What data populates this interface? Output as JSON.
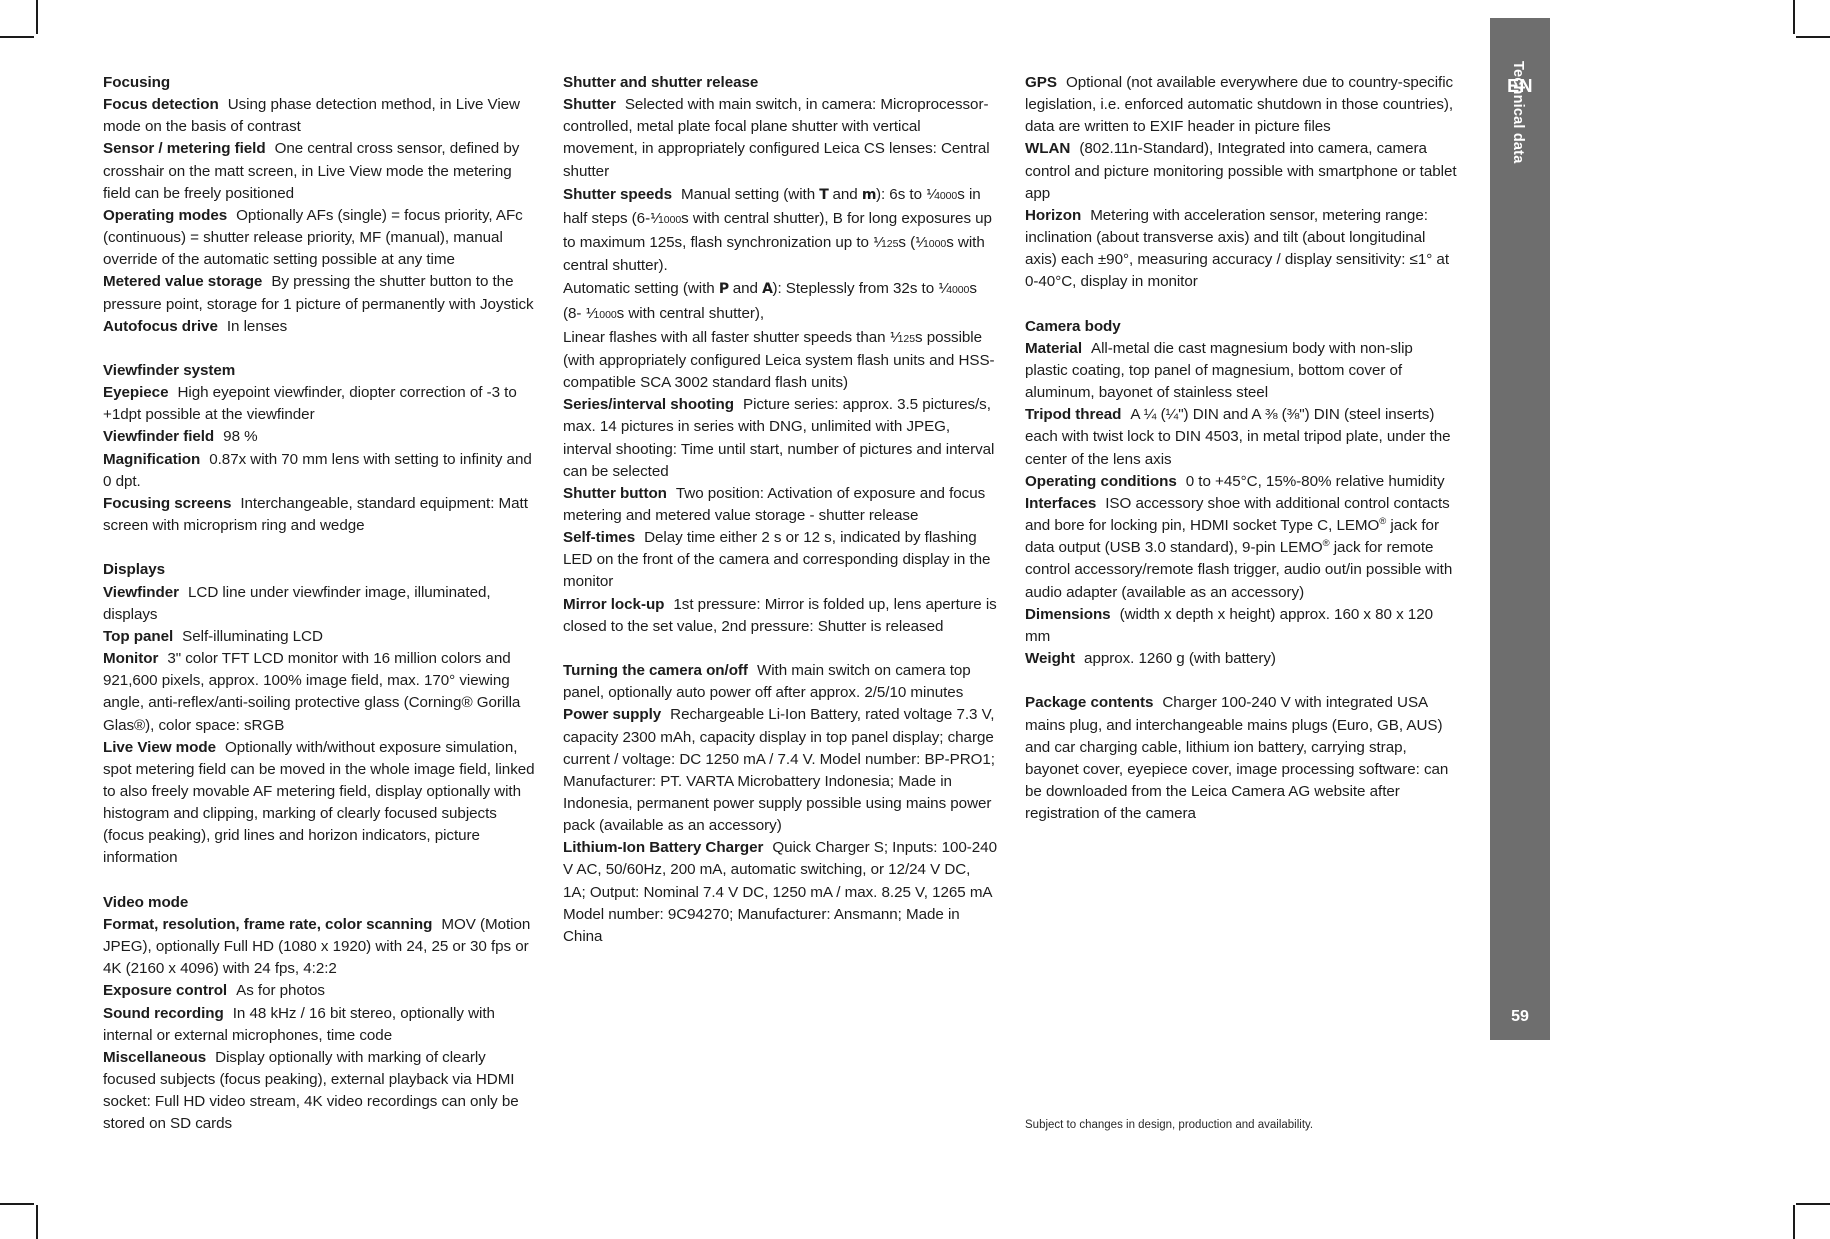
{
  "sidetab": {
    "language": "EN",
    "section": "Technical data",
    "page_number": "59",
    "bg_color": "#6e6e6e"
  },
  "footnote": "Subject to changes in design, production and availability.",
  "columns": [
    {
      "id": "column-1",
      "blocks": [
        {
          "type": "heading",
          "text": "Focusing"
        },
        {
          "type": "entry",
          "term": "Focus detection",
          "value": "Using phase detection method, in Live View mode on the basis of contrast"
        },
        {
          "type": "entry",
          "term": "Sensor / metering field",
          "value": "One central cross sensor, defined by crosshair on the matt screen, in Live View mode the metering field can be freely positioned"
        },
        {
          "type": "entry",
          "term": "Operating modes",
          "value": "Optionally AFs (single) = focus priority, AFc (continuous) = shutter release priority, MF (manual), manual override of the automatic setting possible at any time"
        },
        {
          "type": "entry",
          "term": "Metered value storage",
          "value": "By pressing the shutter button to the pressure point, storage for 1 picture of permanently with Joystick"
        },
        {
          "type": "entry",
          "term": "Autofocus drive",
          "value": "In lenses"
        },
        {
          "type": "spacer"
        },
        {
          "type": "heading",
          "text": "Viewfinder system"
        },
        {
          "type": "entry",
          "term": "Eyepiece",
          "value": "High eyepoint viewfinder, diopter correction of -3 to +1dpt possible at the viewfinder"
        },
        {
          "type": "entry",
          "term": "Viewfinder field",
          "value": "98 %"
        },
        {
          "type": "entry",
          "term": "Magnification",
          "value": "0.87x with 70 mm lens with setting to infinity and 0 dpt."
        },
        {
          "type": "entry",
          "term": "Focusing screens",
          "value": "Interchangeable, standard equipment: Matt screen with microprism ring and wedge"
        },
        {
          "type": "spacer"
        },
        {
          "type": "heading",
          "text": "Displays"
        },
        {
          "type": "entry",
          "term": "Viewfinder",
          "value": "LCD line under viewfinder image, illuminated, displays"
        },
        {
          "type": "entry",
          "term": "Top panel",
          "value": "Self-illuminating LCD"
        },
        {
          "type": "entry",
          "term": "Monitor",
          "value": "3\" color TFT LCD monitor with 16 million colors and 921,600 pixels, approx. 100% image field, max. 170° viewing angle, anti-reflex/anti-soiling protective glass (Corning® Gorilla Glas®), color space: sRGB"
        },
        {
          "type": "entry",
          "term": "Live View mode",
          "value": "Optionally with/without exposure simulation, spot metering field can be moved in the whole image field, linked to also freely movable AF metering field, display optionally with histogram and clipping, marking of clearly focused subjects (focus peaking), grid lines and horizon indicators, picture information"
        },
        {
          "type": "spacer"
        },
        {
          "type": "heading",
          "text": "Video mode"
        },
        {
          "type": "entry",
          "term": "Format, resolution, frame rate, color scanning",
          "value": "MOV (Motion JPEG), optionally Full HD (1080 x 1920) with 24, 25 or 30 fps or 4K (2160 x 4096) with 24 fps, 4:2:2"
        },
        {
          "type": "entry",
          "term": "Exposure control",
          "value": "As for photos"
        },
        {
          "type": "entry",
          "term": "Sound recording",
          "value": "In 48 kHz / 16 bit stereo, optionally with internal or external microphones, time code"
        },
        {
          "type": "entry",
          "term": "Miscellaneous",
          "value": "Display optionally with marking of clearly focused subjects (focus peaking), external playback via HDMI socket: Full HD video stream, 4K video recordings can only be stored on SD cards"
        }
      ]
    },
    {
      "id": "column-2",
      "blocks": [
        {
          "type": "heading",
          "text": "Shutter and shutter release"
        },
        {
          "type": "entry",
          "term": "Shutter",
          "value": "Selected with main switch, in camera: Microprocessor-controlled, metal plate focal plane shutter with vertical movement, in appropriately configured Leica CS lenses: Central shutter"
        },
        {
          "type": "entry-rich",
          "term": "Shutter speeds",
          "value_html": "Manual setting (with <span class=\"lcd\">T</span> and <span class=\"lcd\">m</span>): 6s to <span class=\"frac\"><span class=\"num\">⅟</span><span class=\"den\">4000</span></span>s in half steps (6-<span class=\"frac\"><span class=\"num\">⅟</span><span class=\"den\">1000</span></span>s with central shutter), B for long exposures up to maximum 125s, flash synchronization up to <span class=\"frac\"><span class=\"num\">⅟</span><span class=\"den\">125</span></span>s (<span class=\"frac\"><span class=\"num\">⅟</span><span class=\"den\">1000</span></span>s with central shutter)."
        },
        {
          "type": "entry-rich",
          "term": "",
          "value_html": "Automatic setting (with <span class=\"lcd\">P</span> and <span class=\"lcd\">A</span>): Steplessly from 32s to <span class=\"frac\"><span class=\"num\">⅟</span><span class=\"den\">4000</span></span>s (8- <span class=\"frac\"><span class=\"num\">⅟</span><span class=\"den\">1000</span></span>s with central shutter),"
        },
        {
          "type": "entry-rich",
          "term": "",
          "value_html": "Linear flashes with all faster shutter speeds than <span class=\"frac\"><span class=\"num\">⅟</span><span class=\"den\">125</span></span>s possible (with appropriately configured Leica system flash units and HSS-compatible SCA 3002 standard flash units)"
        },
        {
          "type": "entry",
          "term": "Series/interval shooting",
          "value": "Picture series: approx. 3.5 pictures/s, max. 14 pictures in series with DNG, unlimited with JPEG, interval shooting: Time until start, number of pictures and interval can be selected"
        },
        {
          "type": "entry",
          "term": "Shutter button",
          "value": "Two position: Activation of exposure and focus metering and metered value storage - shutter release"
        },
        {
          "type": "entry",
          "term": "Self-times",
          "value": "Delay time either 2 s or 12 s, indicated by flashing LED on the front of the camera and corresponding display in the monitor"
        },
        {
          "type": "entry",
          "term": "Mirror lock-up",
          "value": "1st pressure: Mirror is folded up, lens aperture is closed to the set value, 2nd pressure: Shutter is released"
        },
        {
          "type": "spacer"
        },
        {
          "type": "entry",
          "term": "Turning the camera on/off",
          "value": "With main switch on camera top panel, optionally auto power off after approx. 2/5/10 minutes"
        },
        {
          "type": "entry",
          "term": "Power supply",
          "value": "Rechargeable Li-Ion Battery, rated voltage 7.3 V, capacity 2300 mAh, capacity display in top  panel display; charge current / voltage: DC 1250 mA / 7.4 V. Model number: BP-PRO1; Manufacturer: PT. VARTA Microbattery Indonesia; Made in Indonesia, permanent power supply possible using mains power pack (available as an accessory)"
        },
        {
          "type": "entry",
          "term": "Lithium-Ion Battery Charger",
          "value": "Quick Charger S; Inputs: 100-240 V AC, 50/60Hz, 200 mA, automatic switching, or 12/24 V DC, 1A; Output: Nominal 7.4 V DC, 1250 mA / max. 8.25 V, 1265 mA Model number: 9C94270; Manufacturer: Ansmann; Made in China"
        }
      ]
    },
    {
      "id": "column-3",
      "blocks": [
        {
          "type": "entry",
          "term": "GPS",
          "value": "Optional (not available everywhere due to country-specific legislation, i.e. enforced automatic shutdown in those countries), data are written to EXIF header in picture files"
        },
        {
          "type": "entry",
          "term": "WLAN",
          "value": "(802.11n-Standard), Integrated into camera, camera control and picture monitoring possible with smartphone or tablet app"
        },
        {
          "type": "entry",
          "term": "Horizon",
          "value": "Metering with acceleration sensor, metering range: inclination (about transverse axis) and tilt (about longitudinal axis) each ±90°, measuring accuracy / display sensitivity: ≤1° at 0-40°C, display in monitor"
        },
        {
          "type": "spacer"
        },
        {
          "type": "heading",
          "text": "Camera body"
        },
        {
          "type": "entry",
          "term": "Material",
          "value": "All-metal die cast magnesium body with non-slip plastic coating, top panel of magnesium, bottom cover of aluminum, bayonet of stainless steel"
        },
        {
          "type": "entry",
          "term": "Tripod thread",
          "value": "A ¼ (¼\") DIN and A ⅜ (⅜\") DIN (steel inserts) each with twist lock to DIN 4503, in metal tripod plate, under the center of the lens axis"
        },
        {
          "type": "entry",
          "term": "Operating conditions",
          "value": "0 to +45°C, 15%-80% relative humidity"
        },
        {
          "type": "entry-rich",
          "term": "Interfaces",
          "value_html": "ISO accessory shoe with additional control contacts and bore for locking pin, HDMI socket Type C, LEMO<sup>®</sup> jack for data output (USB 3.0 standard), 9-pin LEMO<sup>®</sup> jack for remote control accessory/remote flash trigger, audio out/in possible with audio adapter (available as an accessory)"
        },
        {
          "type": "entry",
          "term": "Dimensions",
          "value": "(width x depth x height)        approx. 160 x 80 x 120 mm"
        },
        {
          "type": "entry",
          "term": "Weight",
          "value": "approx. 1260 g (with battery)"
        },
        {
          "type": "spacer"
        },
        {
          "type": "entry",
          "term": "Package contents",
          "value": "Charger 100-240 V with integrated USA mains plug, and interchangeable mains plugs (Euro, GB, AUS) and car charging cable, lithium ion battery, carrying strap, bayonet cover, eyepiece cover, image processing software: can be downloaded from the Leica Camera AG website after registration of the camera"
        }
      ]
    }
  ]
}
